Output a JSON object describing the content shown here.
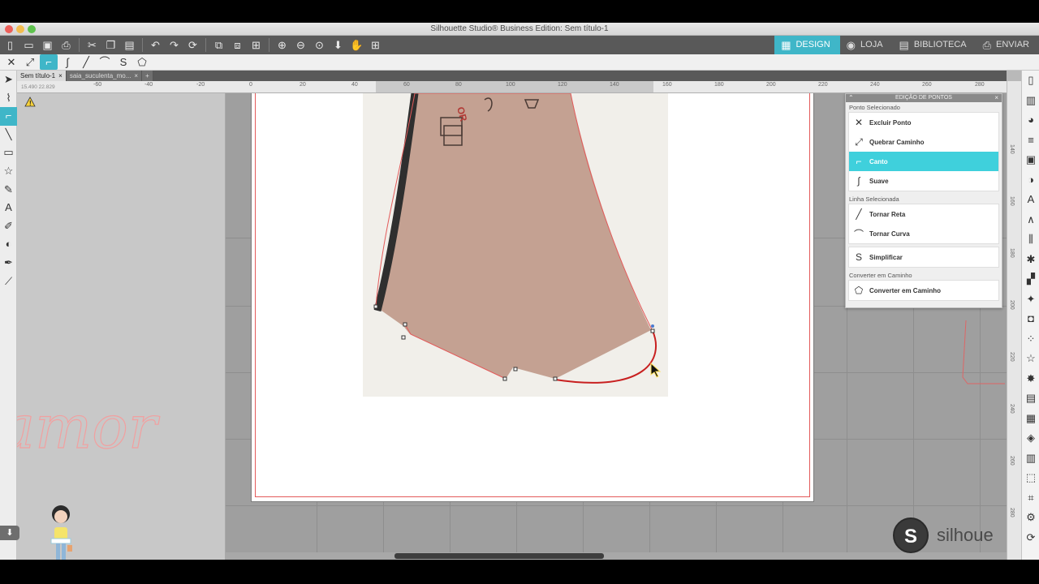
{
  "window": {
    "title": "Silhouette Studio® Business Edition: Sem título-1"
  },
  "toolbar": {
    "icons": [
      "new-file",
      "open-folder",
      "save",
      "print",
      "cut",
      "copy",
      "paste",
      "undo",
      "redo",
      "refresh",
      "group",
      "ungroup",
      "select-all",
      "zoom-in",
      "zoom-out",
      "zoom-fit",
      "move-down",
      "pan-hand",
      "add-page"
    ]
  },
  "nav": {
    "design": "DESIGN",
    "store": "LOJA",
    "library": "BIBLIOTECA",
    "send": "ENVIAR"
  },
  "doc_tabs": [
    {
      "label": "Sem título-1",
      "close": "×"
    },
    {
      "label": "saia_suculenta_mo...",
      "close": "×"
    },
    {
      "label": "+"
    }
  ],
  "ruler": {
    "coords": "15.490   22.829",
    "h_ticks": [
      "-60",
      "-40",
      "-20",
      "0",
      "20",
      "40",
      "60",
      "80",
      "100",
      "120",
      "140",
      "160",
      "180",
      "200",
      "220",
      "240",
      "260",
      "280"
    ],
    "v_ticks": [
      "140",
      "160",
      "180",
      "200",
      "220",
      "240",
      "260",
      "280"
    ]
  },
  "panel": {
    "title": "EDIÇÃO DE PONTOS",
    "section_point": "Ponto Selecionado",
    "delete_point": "Excluir Ponto",
    "break_path": "Quebrar Caminho",
    "corner": "Canto",
    "smooth": "Suave",
    "section_line": "Linha Selecionada",
    "make_straight": "Tornar Reta",
    "make_curve": "Tornar Curva",
    "simplify": "Simplificar",
    "section_convert": "Converter em Caminho",
    "convert_path": "Converter em Caminho"
  },
  "logo": {
    "text": "silhoue"
  },
  "colors": {
    "accent": "#3fb6c8",
    "accent_selected": "#3fd0dc",
    "cut_line": "#e35a5a",
    "paper": "#c4a192"
  }
}
